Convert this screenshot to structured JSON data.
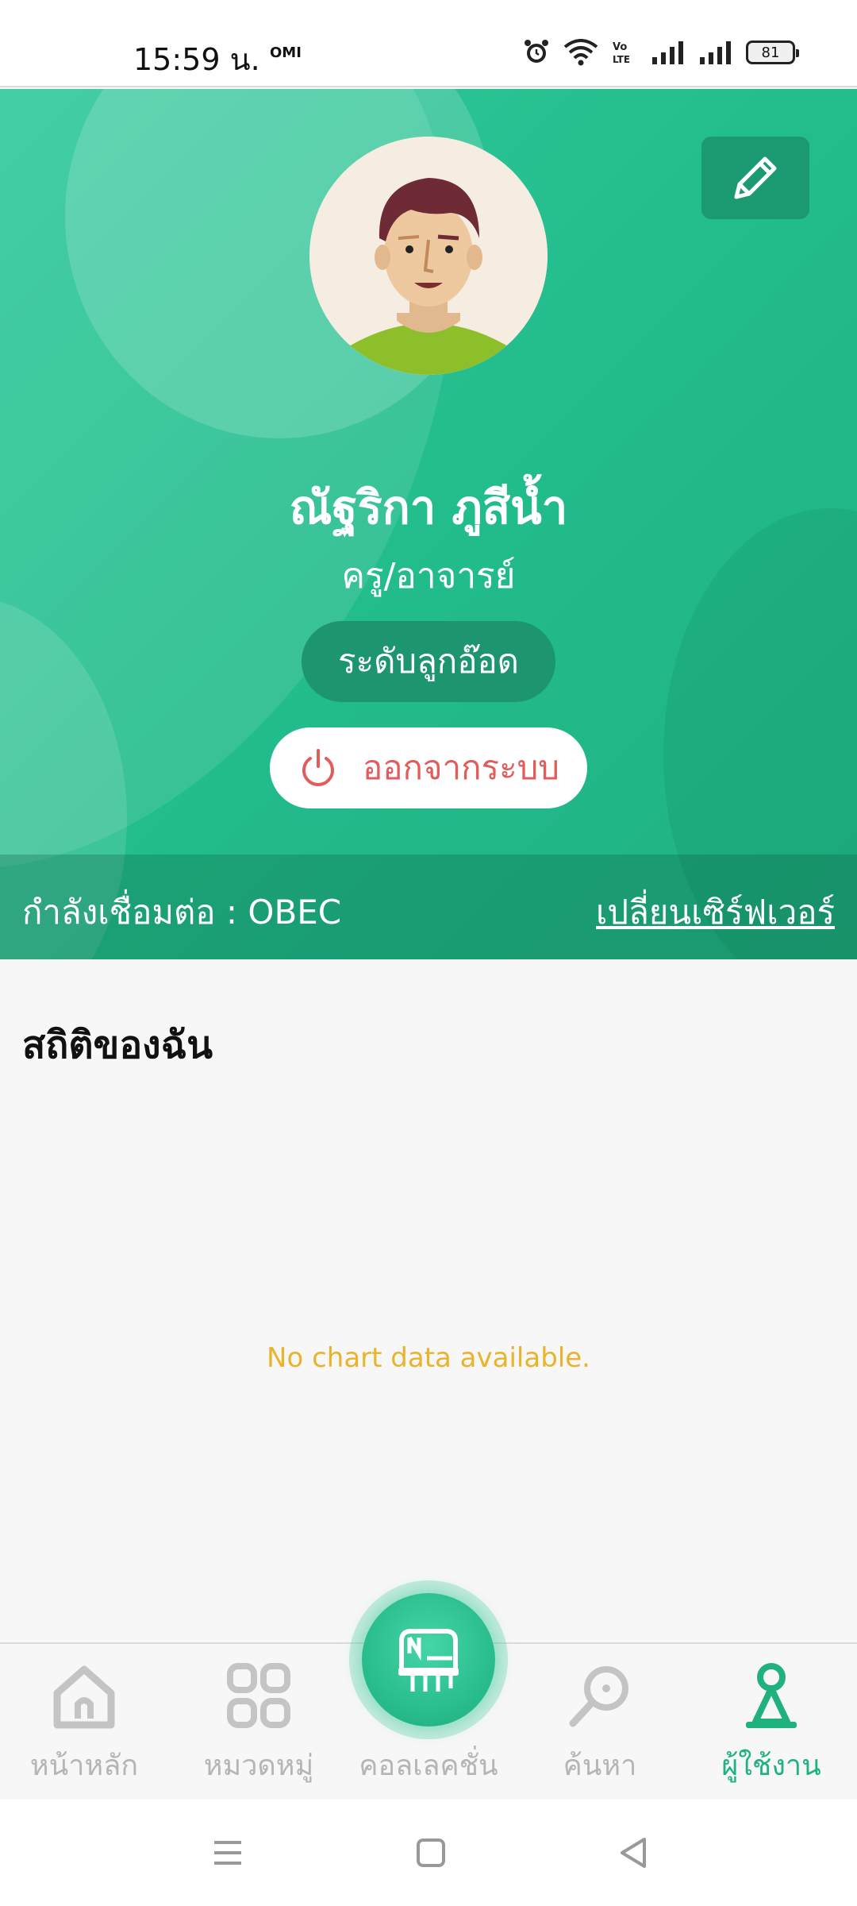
{
  "status_bar": {
    "time": "15:59 น.",
    "carrier_tag": "OMI",
    "battery": "81"
  },
  "profile": {
    "name": "ณัฐริกา ภูสีน้ำ",
    "role": "ครู/อาจารย์",
    "level": "ระดับลูกอ๊อด",
    "logout_label": "ออกจากระบบ"
  },
  "server": {
    "label": "กำลังเชื่อมต่อ : OBEC",
    "change_label": "เปลี่ยนเซิร์ฟเวอร์"
  },
  "stats": {
    "title": "สถิติของฉัน",
    "empty_message": "No chart data available."
  },
  "bottom_nav": {
    "items": [
      {
        "label": "หน้าหลัก",
        "icon": "home-icon"
      },
      {
        "label": "หมวดหมู่",
        "icon": "category-icon"
      },
      {
        "label": "คอลเลคชั่น",
        "icon": "collection-icon"
      },
      {
        "label": "ค้นหา",
        "icon": "search-icon"
      },
      {
        "label": "ผู้ใช้งาน",
        "icon": "user-icon",
        "active": true
      }
    ]
  },
  "colors": {
    "accent": "#22bb8b",
    "logout": "#e25c5c",
    "warning_text": "#eab32c"
  }
}
